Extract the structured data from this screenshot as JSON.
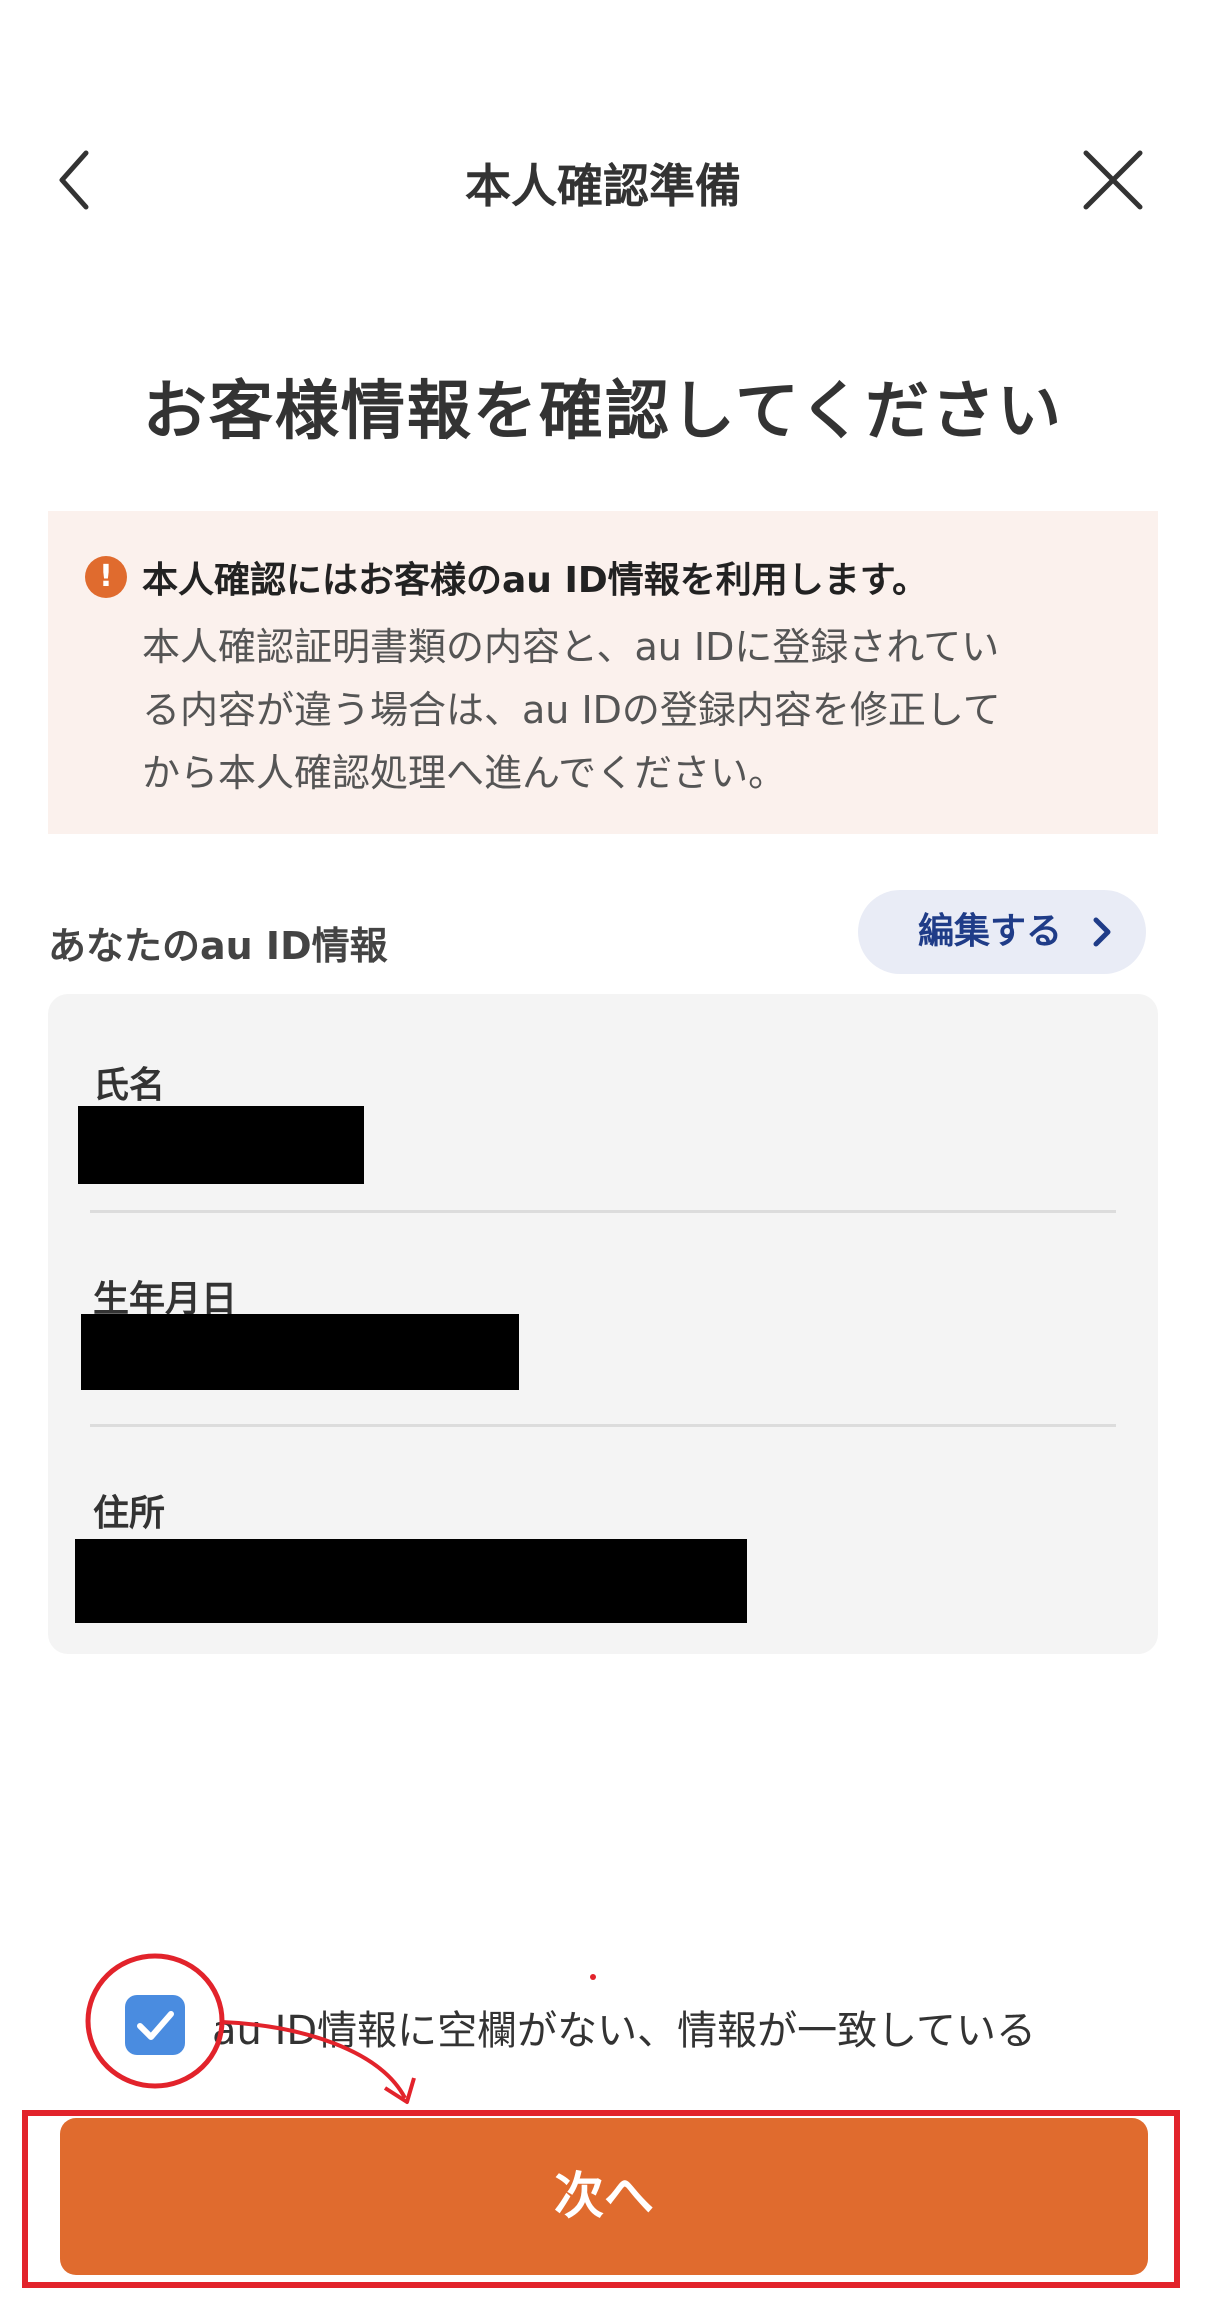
{
  "header": {
    "title": "本人確認準備",
    "back_icon": "chevron-left-icon",
    "close_icon": "close-icon"
  },
  "page_title": "お客様情報を確認してください",
  "notice": {
    "icon": "exclamation-icon",
    "icon_glyph": "!",
    "heading": "本人確認にはお客様のau ID情報を利用します。",
    "lines": [
      "本人確認証明書類の内容と、au IDに登録されてい",
      "る内容が違う場合は、au IDの登録内容を修正して",
      "から本人確認処理へ進んでください。"
    ]
  },
  "info_section": {
    "label": "あなたのau ID情報",
    "edit_label": "編集する",
    "fields": [
      {
        "label": "氏名"
      },
      {
        "label": "生年月日"
      },
      {
        "label": "住所"
      }
    ]
  },
  "confirm": {
    "checked": true,
    "label": "au ID情報に空欄がない、情報が一致している"
  },
  "next_button": {
    "label": "次へ"
  },
  "colors": {
    "accent": "#e06b2e",
    "notice_bg": "#fbf1ed",
    "edit_text": "#1f3c88",
    "edit_bg": "#e9ecf6",
    "checkbox": "#4a8ce0",
    "annotation": "#e2232b"
  }
}
